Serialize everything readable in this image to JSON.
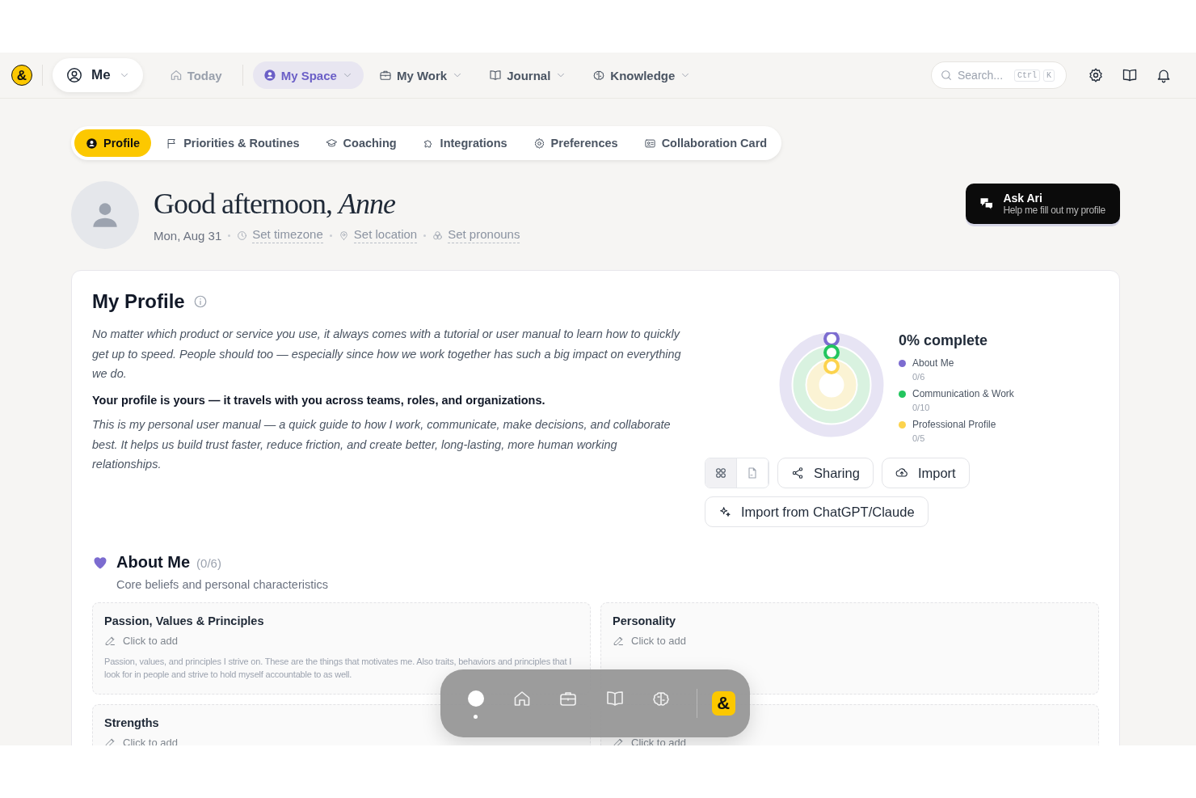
{
  "logo": "&",
  "nav": {
    "me": "Me",
    "items": [
      {
        "label": "Today",
        "selected": false,
        "dropdown": false
      },
      {
        "label": "My Space",
        "selected": true,
        "dropdown": true
      },
      {
        "label": "My Work",
        "selected": false,
        "dropdown": true
      },
      {
        "label": "Journal",
        "selected": false,
        "dropdown": true
      },
      {
        "label": "Knowledge",
        "selected": false,
        "dropdown": true
      }
    ],
    "search": {
      "placeholder": "Search...",
      "keys": [
        "Ctrl",
        "K"
      ]
    }
  },
  "tabs": [
    {
      "label": "Profile",
      "selected": true
    },
    {
      "label": "Priorities & Routines",
      "selected": false
    },
    {
      "label": "Coaching",
      "selected": false
    },
    {
      "label": "Integrations",
      "selected": false
    },
    {
      "label": "Preferences",
      "selected": false
    },
    {
      "label": "Collaboration Card",
      "selected": false
    }
  ],
  "greeting": "Good afternoon, *Anne*",
  "date": "Mon, Aug 31",
  "meta_links": [
    "Set timezone",
    "Set location",
    "Set pronouns"
  ],
  "ask": {
    "title": "Ask Ari",
    "subtitle": "Help me fill out my profile"
  },
  "profile": {
    "title": "My Profile",
    "paragraphs": [
      {
        "kind": "italic",
        "text": "No matter which product or service you use, it always comes with a tutorial or user manual to learn how to quickly get up to speed. People should too — especially since how we work together has such a big impact on everything we do."
      },
      {
        "kind": "bold",
        "text": "Your profile is yours — it travels with you across teams, roles, and organizations."
      },
      {
        "kind": "italic",
        "text": "This is my personal user manual — a quick guide to how I work, communicate, make decisions, and collaborate best. It helps us build trust faster, reduce friction, and create better, long-lasting, more human working relationships."
      }
    ],
    "completion": "0% complete",
    "legend": [
      {
        "label": "About Me",
        "count": "0/6",
        "color": "#7c6cd0"
      },
      {
        "label": "Communication & Work",
        "count": "0/10",
        "color": "#22c55e"
      },
      {
        "label": "Professional Profile",
        "count": "0/5",
        "color": "#fcd34d"
      }
    ],
    "views": [
      {
        "selected": true
      },
      {
        "selected": false
      }
    ],
    "buttons": [
      "Sharing",
      "Import"
    ],
    "import_ai": "Import from ChatGPT/Claude"
  },
  "section": {
    "title": "About Me",
    "count": "(0/6)",
    "subtitle": "Core beliefs and personal characteristics",
    "cards": [
      {
        "title": "Passion, Values & Principles",
        "action": "Click to add",
        "description": "Passion, values, and principles I strive on. These are the things that motivates me. Also traits, behaviors and principles that I look for in people and strive to hold myself accountable to as well."
      },
      {
        "title": "Personality",
        "action": "Click to add"
      },
      {
        "title": "Strengths",
        "action": "Click to add"
      },
      {
        "action": "Click to add"
      }
    ]
  },
  "dock": {
    "items": [
      {
        "selected": true
      },
      {
        "selected": false
      },
      {
        "selected": false
      },
      {
        "selected": false
      },
      {
        "selected": false
      }
    ],
    "logo": "&"
  }
}
